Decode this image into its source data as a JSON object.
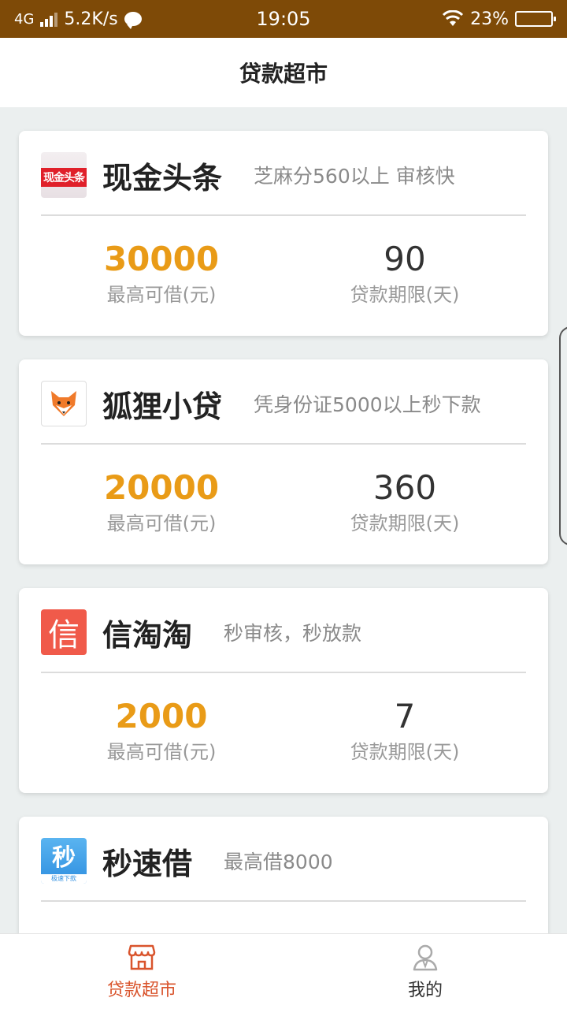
{
  "status_bar": {
    "network": "4G",
    "speed": "5.2K/s",
    "time": "19:05",
    "battery": "23%",
    "battery_level": 0.23
  },
  "header": {
    "title": "贷款超市"
  },
  "products": [
    {
      "name": "现金头条",
      "logo_text": "现金头条",
      "tagline": "芝麻分560以上 审核快",
      "amount": "30000",
      "amount_label": "最高可借(元)",
      "term": "90",
      "term_label": "贷款期限(天)"
    },
    {
      "name": "狐狸小贷",
      "tagline": "凭身份证5000以上秒下款",
      "amount": "20000",
      "amount_label": "最高可借(元)",
      "term": "360",
      "term_label": "贷款期限(天)"
    },
    {
      "name": "信淘淘",
      "logo_text": "信",
      "tagline": "秒审核，秒放款",
      "amount": "2000",
      "amount_label": "最高可借(元)",
      "term": "7",
      "term_label": "贷款期限(天)"
    },
    {
      "name": "秒速借",
      "logo_text": "秒",
      "logo_subtext": "极速下款",
      "tagline": "最高借8000"
    }
  ],
  "tabs": [
    {
      "label": "贷款超市",
      "icon": "store-icon",
      "active": true
    },
    {
      "label": "我的",
      "icon": "person-icon",
      "active": false
    }
  ],
  "colors": {
    "accent": "#e99b17",
    "tab_active": "#d9542c",
    "status_bar": "#7e4a07"
  }
}
